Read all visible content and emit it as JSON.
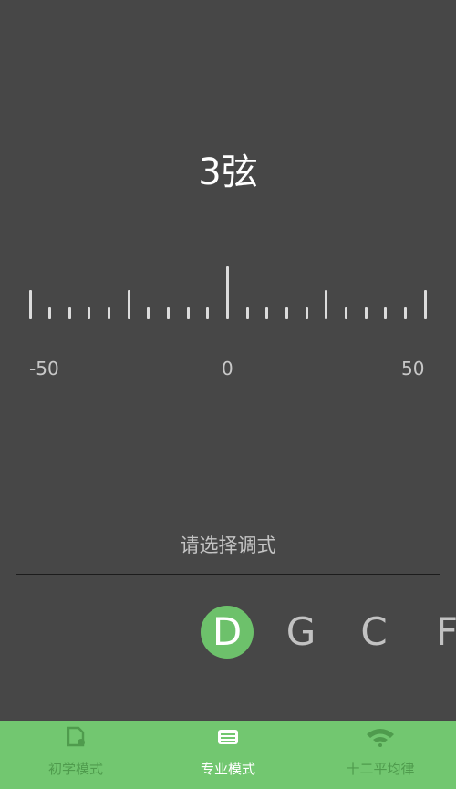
{
  "tuner": {
    "string_label": "3弦",
    "scale_labels": {
      "left": "-50",
      "center": "0",
      "right": "50"
    },
    "prompt": "请选择调式"
  },
  "tunings": [
    {
      "label": "D",
      "selected": true
    },
    {
      "label": "G",
      "selected": false
    },
    {
      "label": "C",
      "selected": false
    },
    {
      "label": "F",
      "selected": false
    }
  ],
  "tabbar": {
    "tabs": [
      {
        "label": "初学模式",
        "icon": "file-settings-icon",
        "active": false
      },
      {
        "label": "专业模式",
        "icon": "wallet-card-icon",
        "active": true
      },
      {
        "label": "十二平均律",
        "icon": "wifi-arc-icon",
        "active": false
      }
    ]
  },
  "colors": {
    "background": "#474747",
    "accent": "#6dc16b",
    "tabbar_bg": "#72c770",
    "tabbar_inactive": "#4f9b4d",
    "tick": "#dcdcdc"
  }
}
